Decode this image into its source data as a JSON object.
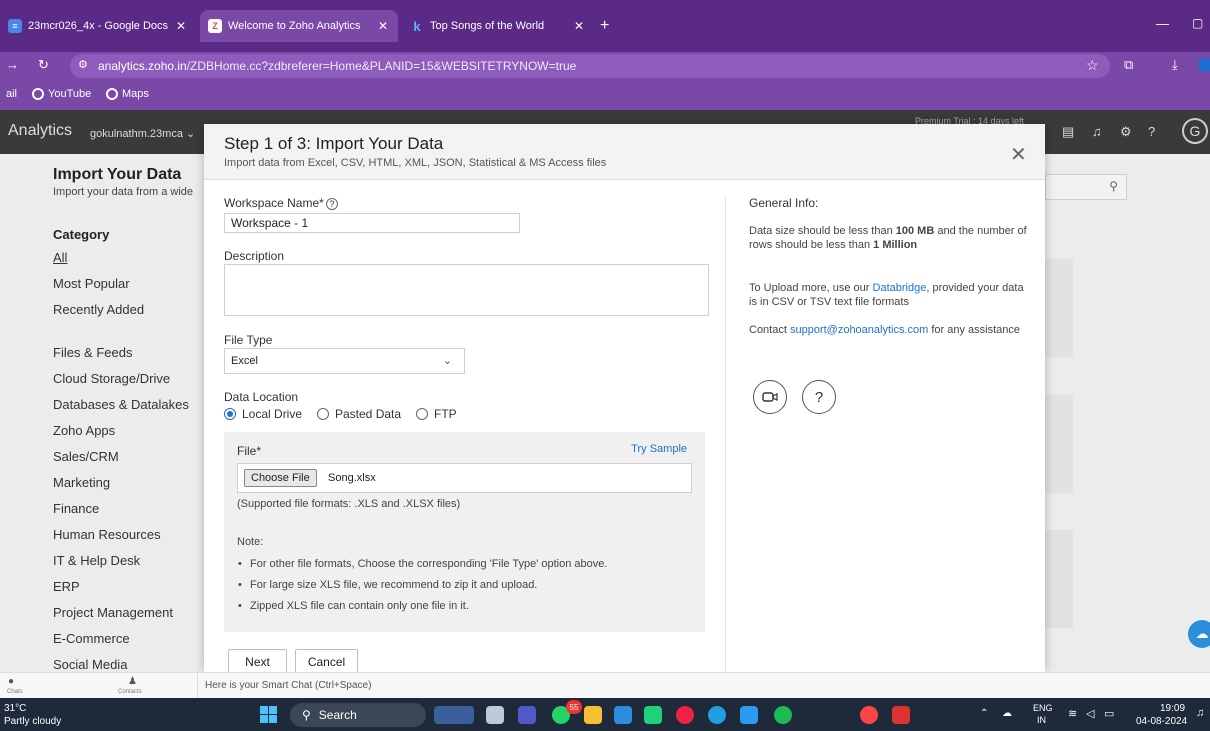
{
  "browser": {
    "tabs": [
      {
        "title": "23mcr026_4x - Google Docs",
        "active": false
      },
      {
        "title": "Welcome to Zoho Analytics",
        "active": true
      },
      {
        "title": "Top Songs of the World",
        "active": false
      }
    ],
    "new_tab": "+",
    "url_host": "analytics.zoho.in",
    "url_path": "/ZDBHome.cc?zdbreferer=Home&PLANID=15&WEBSITETRYNOW=true",
    "bookmarks": [
      "ail",
      "YouTube",
      "Maps"
    ]
  },
  "app": {
    "name": "Analytics",
    "user": "gokulnathm.23mca",
    "trial_text": "Premium Trial : 14 days left",
    "avatar": "G"
  },
  "page": {
    "title": "Import Your Data",
    "subtitle": "Import your data from a wide",
    "category_heading": "Category",
    "categories": [
      "All",
      "Most Popular",
      "Recently Added",
      "Files & Feeds",
      "Cloud Storage/Drive",
      "Databases & Datalakes",
      "Zoho Apps",
      "Sales/CRM",
      "Marketing",
      "Finance",
      "Human Resources",
      "IT & Help Desk",
      "ERP",
      "Project Management",
      "E-Commerce",
      "Social Media"
    ]
  },
  "modal": {
    "title": "Step 1 of 3: Import Your Data",
    "subtitle": "Import data from Excel, CSV, HTML, XML, JSON, Statistical & MS Access files",
    "workspace_label": "Workspace Name*",
    "workspace_value": "Workspace - 1",
    "description_label": "Description",
    "file_type_label": "File Type",
    "file_type_value": "Excel",
    "data_location_label": "Data Location",
    "locations": [
      "Local Drive",
      "Pasted Data",
      "FTP"
    ],
    "file_label": "File*",
    "try_sample": "Try Sample",
    "choose_file": "Choose File",
    "file_name": "Song.xlsx",
    "supported": "(Supported file formats: .XLS and .XLSX files)",
    "note_label": "Note:",
    "notes": [
      "For other file formats, Choose the corresponding 'File Type' option above.",
      "For large size XLS file, we recommend to zip it and upload.",
      "Zipped XLS file can contain only one file in it."
    ],
    "next_button": "Next",
    "cancel_button": "Cancel",
    "general_info_title": "General Info:",
    "info1_a": "Data size should be less than ",
    "info1_b": "100 MB",
    "info1_c": " and the number of rows should be less than ",
    "info1_d": "1 Million",
    "info2_a": "To Upload more, use our ",
    "info2_link": "Databridge",
    "info2_b": ", provided your data is in CSV or TSV text file formats",
    "info3_a": "Contact ",
    "info3_link": "support@zohoanalytics.com",
    "info3_b": " for any assistance"
  },
  "smartchat": {
    "chats": "Chats",
    "contacts": "Contacts",
    "placeholder": "Here is your Smart Chat (Ctrl+Space)"
  },
  "taskbar": {
    "weather_temp": "31°C",
    "weather_desc": "Partly cloudy",
    "search": "Search",
    "badge": "55",
    "lang1": "ENG",
    "lang2": "IN",
    "time": "19:09",
    "date": "04-08-2024"
  }
}
